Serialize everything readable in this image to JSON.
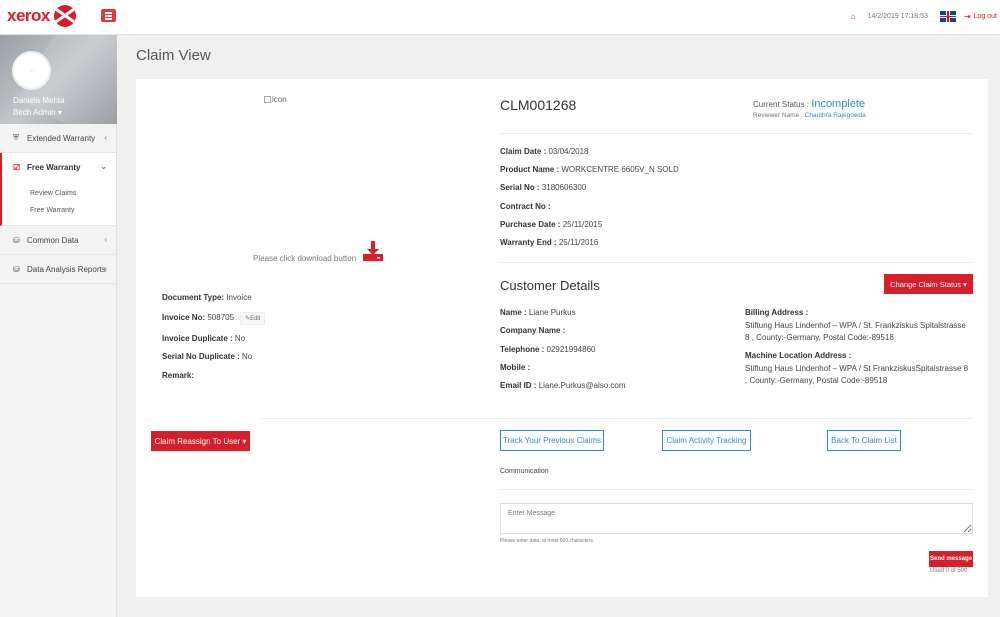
{
  "topbar": {
    "logo_text": "xerox",
    "datetime": "14/2/2019 17:18:53",
    "logout_label": "Log out",
    "home_icon": "home-icon",
    "flag_icon": "uk-flag-icon"
  },
  "sidebar": {
    "profile": {
      "name": "Daniela Mehta",
      "role": "Birch Admin ▾"
    },
    "items": [
      {
        "label": "Extended Warranty",
        "icon": "shield-icon",
        "chevron": "‹"
      },
      {
        "label": "Free Warranty",
        "icon": "checkbox-icon",
        "chevron": "⌄"
      },
      {
        "label": "Common Data",
        "icon": "database-icon",
        "chevron": "‹"
      },
      {
        "label": "Data Analysis Reports",
        "icon": "database-icon",
        "chevron": "‹"
      }
    ],
    "subitems": [
      {
        "label": "Review Claims"
      },
      {
        "label": "Free Warranty"
      }
    ]
  },
  "page": {
    "title": "Claim View"
  },
  "document": {
    "image_alt": "icon",
    "download_text": "Please click download button",
    "doc_type_label": "Document Type:",
    "doc_type_value": "Invoice",
    "invoice_no_label": "Invoice No:",
    "invoice_no_value": "508705",
    "edit_label": "Edit",
    "invoice_dup_label": "Invoice Duplicate :",
    "invoice_dup_value": "No",
    "serial_dup_label": "Serial No Duplicate :",
    "serial_dup_value": "No",
    "remark_label": "Remark:",
    "remark_value": ""
  },
  "claim": {
    "number": "CLM001268",
    "status_label": "Current Status :",
    "status_value": "Incomplete",
    "reviewer_label": "Reviewer Name :",
    "reviewer_value": "Charithra Rajegowda",
    "fields": [
      {
        "label": "Claim Date :",
        "value": "03/04/2018"
      },
      {
        "label": "Product Name :",
        "value": "WORKCENTRE 6605V_N SOLD"
      },
      {
        "label": "Serial No :",
        "value": "3180606300"
      },
      {
        "label": "Contract No :",
        "value": ""
      },
      {
        "label": "Purchase Date :",
        "value": "25/11/2015"
      },
      {
        "label": "Warranty End :",
        "value": "25/11/2016"
      }
    ]
  },
  "customer": {
    "title": "Customer Details",
    "change_status_label": "Change Claim Status ▾",
    "fields": [
      {
        "label": "Name :",
        "value": "Liane Purkus"
      },
      {
        "label": "Company Name :",
        "value": ""
      },
      {
        "label": "Telephone :",
        "value": "02921994860"
      },
      {
        "label": "Mobile :",
        "value": ""
      },
      {
        "label": "Email ID :",
        "value": "Liane.Purkus@also.com"
      }
    ],
    "billing_label": "Billing Address :",
    "billing_value": "Stiftung Haus Lindenhof – WPA / St. Frankziskus Spitalstrasse 8 , County:-Germany, Postal Code:-89518",
    "machine_label": "Machine Location Address :",
    "machine_value": "Stiftung Haus Lindenhof – WPA / St FrankziskusSpitalstrasse 8 , County:-Germany, Postal Code:-89518"
  },
  "actions": {
    "reassign_label": "Claim Reassign To User ▾",
    "track_label": "Track Your Previous Claims",
    "activity_label": "Claim Activity Tracking",
    "back_label": "Back To Claim List"
  },
  "communication": {
    "label": "Communication",
    "placeholder": "Enter Message",
    "hint": "Please enter data, at most 500 characters.",
    "send_label": "Send message",
    "char_count": "Used 0 of 500"
  },
  "colors": {
    "brand": "#d71f2b",
    "link": "#2a8fc7"
  }
}
